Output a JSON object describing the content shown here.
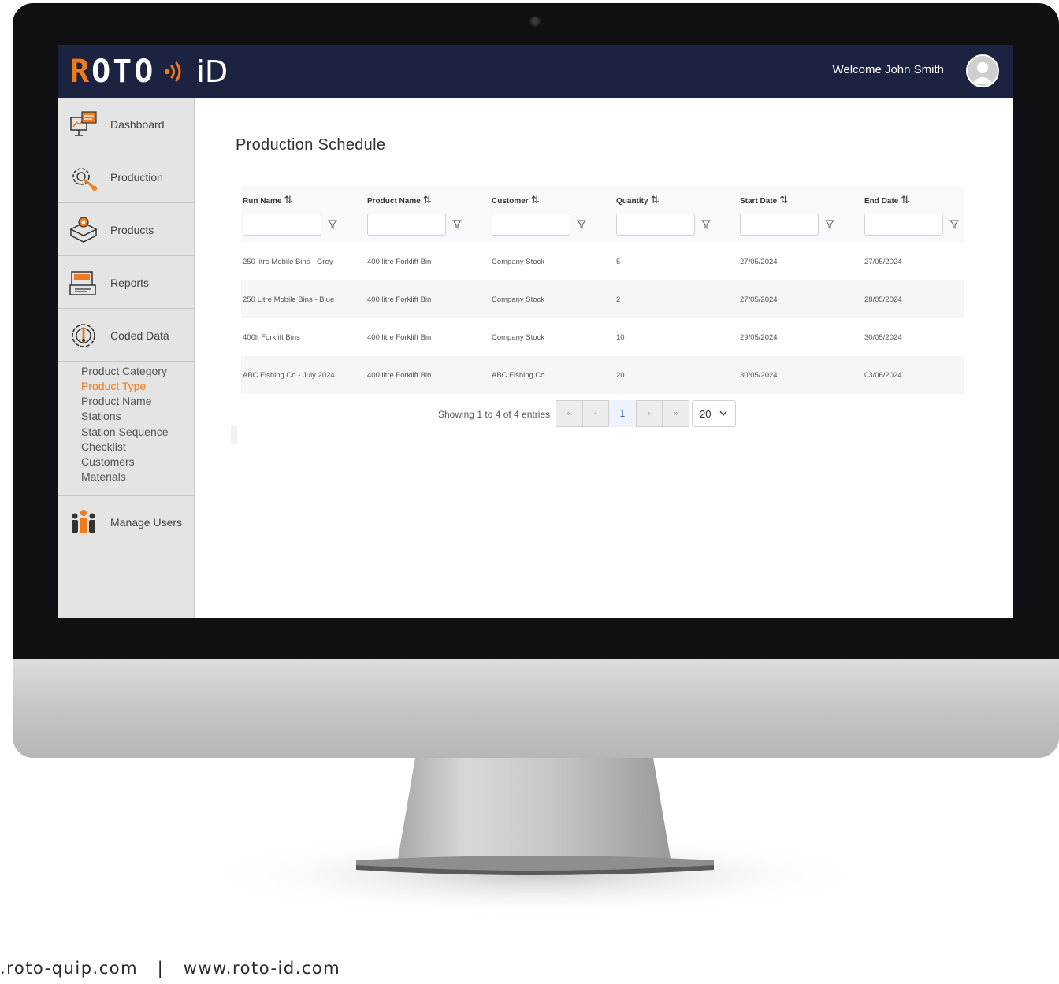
{
  "header": {
    "logo_text_r": "R",
    "logo_text_rest": "OTO",
    "logo_id": "iD",
    "welcome": "Welcome John Smith"
  },
  "sidebar": {
    "items": [
      {
        "label": "Dashboard",
        "icon": "dashboard-icon"
      },
      {
        "label": "Production",
        "icon": "gear-wrench-icon"
      },
      {
        "label": "Products",
        "icon": "products-box-icon"
      },
      {
        "label": "Reports",
        "icon": "reports-icon"
      },
      {
        "label": "Coded Data",
        "icon": "coded-data-icon"
      },
      {
        "label": "Manage Users",
        "icon": "users-icon"
      }
    ],
    "coded_data_sub": [
      {
        "label": "Product Category",
        "active": false
      },
      {
        "label": "Product Type",
        "active": true
      },
      {
        "label": "Product Name",
        "active": false
      },
      {
        "label": "Stations",
        "active": false
      },
      {
        "label": "Station Sequence",
        "active": false
      },
      {
        "label": "Checklist",
        "active": false
      },
      {
        "label": "Customers",
        "active": false
      },
      {
        "label": "Materials",
        "active": false
      }
    ]
  },
  "main": {
    "title": "Production Schedule",
    "columns": [
      "Run Name",
      "Product Name",
      "Customer",
      "Quantity",
      "Start Date",
      "End Date"
    ],
    "rows": [
      [
        "250 litre Mobile Bins - Grey",
        "400 litre Forklift Bin",
        "Company Stock",
        "5",
        "27/05/2024",
        "27/05/2024"
      ],
      [
        "250 Litre Mobile Bins - Blue",
        "400 litre Forklift Bin",
        "Company Stock",
        "2",
        "27/05/2024",
        "28/05/2024"
      ],
      [
        "400lt Forklift Bins",
        "400 litre Forklift Bin",
        "Company Stock",
        "10",
        "29/05/2024",
        "30/05/2024"
      ],
      [
        "ABC Fishing Co - July 2024",
        "400 litre Forklift Bin",
        "ABC Fishing Co",
        "20",
        "30/05/2024",
        "03/06/2024"
      ]
    ],
    "pagination": {
      "info": "Showing 1 to 4 of 4 entries",
      "first": "«",
      "prev": "‹",
      "current": "1",
      "next": "›",
      "last": "»",
      "page_size": "20"
    }
  },
  "footer": {
    "text": ".roto-quip.com   |   www.roto-id.com"
  },
  "colors": {
    "header_bg": "#1b2340",
    "accent": "#f07b1d",
    "sidebar_bg": "#e4e4e4"
  }
}
